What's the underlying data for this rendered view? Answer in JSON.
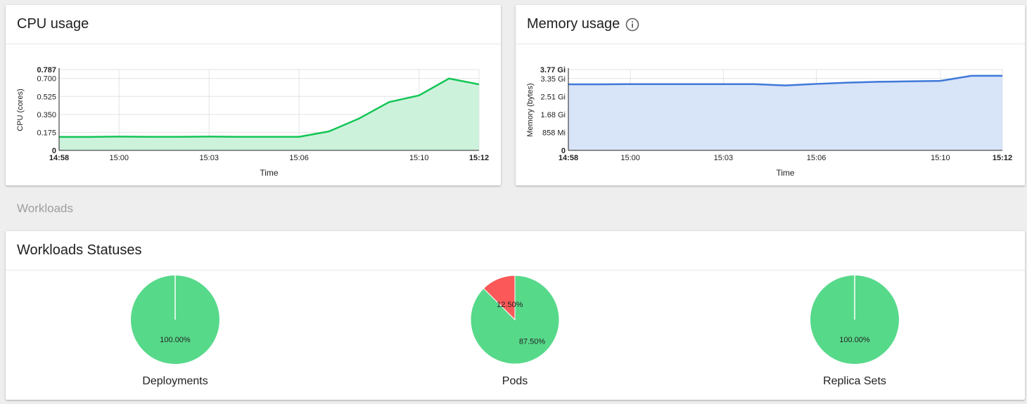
{
  "cpu": {
    "title": "CPU usage",
    "chart_data": {
      "type": "area",
      "ylabel": "CPU (cores)",
      "xlabel": "Time",
      "ylim": [
        0,
        0.787
      ],
      "y_ticks": [
        "0",
        "0.175",
        "0.350",
        "0.525",
        "0.700",
        "0.787"
      ],
      "x_ticks": [
        "14:58",
        "15:00",
        "15:03",
        "15:06",
        "15:10",
        "15:12"
      ],
      "x": [
        "14:58",
        "14:59",
        "15:00",
        "15:01",
        "15:02",
        "15:03",
        "15:04",
        "15:05",
        "15:06",
        "15:07",
        "15:08",
        "15:09",
        "15:10",
        "15:11",
        "15:12"
      ],
      "values": [
        0.131,
        0.131,
        0.134,
        0.132,
        0.132,
        0.134,
        0.132,
        0.132,
        0.132,
        0.185,
        0.31,
        0.47,
        0.535,
        0.7,
        0.643
      ],
      "line_color": "#12c555",
      "fill_color": "#cdf2dc"
    }
  },
  "memory": {
    "title": "Memory usage",
    "info_icon": "info-icon",
    "chart_data": {
      "type": "area",
      "ylabel": "Memory (bytes)",
      "xlabel": "Time",
      "ylim": [
        0,
        3.77
      ],
      "y_unit": "Gi",
      "y_ticks": [
        "0",
        "858 Mi",
        "1.68 Gi",
        "2.51 Gi",
        "3.35 Gi",
        "3.77 Gi"
      ],
      "x_ticks": [
        "14:58",
        "15:00",
        "15:03",
        "15:06",
        "15:10",
        "15:12"
      ],
      "x": [
        "14:58",
        "14:59",
        "15:00",
        "15:01",
        "15:02",
        "15:03",
        "15:04",
        "15:05",
        "15:06",
        "15:07",
        "15:08",
        "15:09",
        "15:10",
        "15:11",
        "15:12"
      ],
      "values": [
        3.08,
        3.08,
        3.09,
        3.09,
        3.09,
        3.09,
        3.09,
        3.03,
        3.1,
        3.16,
        3.2,
        3.22,
        3.24,
        3.48,
        3.48
      ],
      "line_color": "#3f78d9",
      "fill_color": "#d8e4f8"
    }
  },
  "section": {
    "workloads_label": "Workloads"
  },
  "workloads": {
    "title": "Workloads Statuses",
    "chart_data": [
      {
        "type": "pie",
        "label": "Deployments",
        "slices": [
          {
            "value": 100.0,
            "text": "100.00%",
            "color": "#57d98a"
          }
        ]
      },
      {
        "type": "pie",
        "label": "Pods",
        "slices": [
          {
            "value": 87.5,
            "text": "87.50%",
            "color": "#57d98a"
          },
          {
            "value": 12.5,
            "text": "12.50%",
            "color": "#fb5959"
          }
        ]
      },
      {
        "type": "pie",
        "label": "Replica Sets",
        "slices": [
          {
            "value": 100.0,
            "text": "100.00%",
            "color": "#57d98a"
          }
        ]
      }
    ]
  }
}
